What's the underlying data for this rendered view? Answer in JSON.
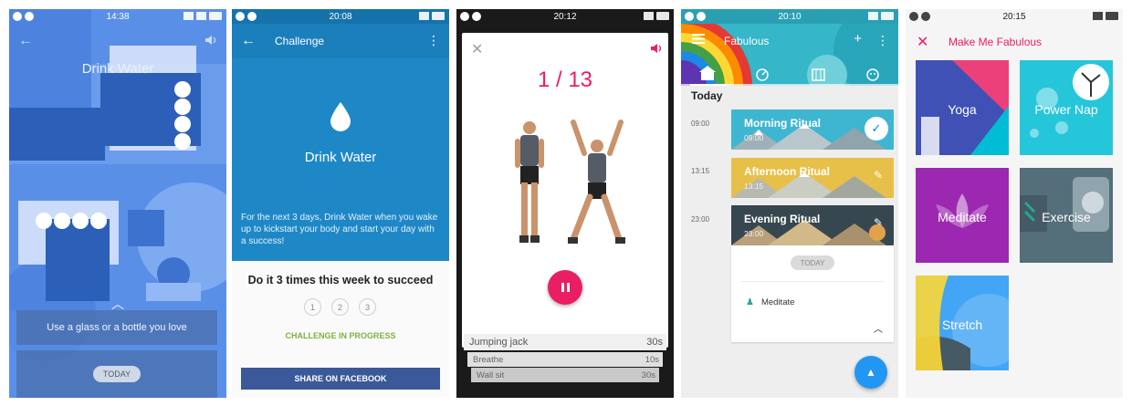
{
  "screens": [
    {
      "status_time": "14:38",
      "title": "Drink Water",
      "tip": "Use a glass or a bottle you love",
      "today_label": "TODAY"
    },
    {
      "status_time": "20:08",
      "appbar_title": "Challenge",
      "habit_name": "Drink Water",
      "description": "For the next 3 days, Drink Water when you wake up to kickstart your body and start your day with a success!",
      "goal": "Do it 3 times this week to succeed",
      "steps": [
        "1",
        "2",
        "3"
      ],
      "status": "CHALLENGE IN PROGRESS",
      "share_label": "SHARE ON FACEBOOK"
    },
    {
      "status_time": "20:12",
      "counter": "1 / 13",
      "queue": [
        {
          "name": "Jumping jack",
          "duration": "30s"
        },
        {
          "name": "Breathe",
          "duration": "10s"
        },
        {
          "name": "Wall sit",
          "duration": "30s"
        }
      ]
    },
    {
      "status_time": "20:10",
      "appbar_title": "Fabulous",
      "section": "Today",
      "rituals": [
        {
          "time": "09:00",
          "name": "Morning Ritual",
          "sub": "09:00"
        },
        {
          "time": "13:15",
          "name": "Afternoon Ritual",
          "sub": "13:15"
        },
        {
          "time": "23:00",
          "name": "Evening Ritual",
          "sub": "23:00"
        }
      ],
      "today_pill": "TODAY",
      "habit": "Meditate"
    },
    {
      "status_time": "20:15",
      "title": "Make Me Fabulous",
      "tiles": [
        "Yoga",
        "Power Nap",
        "Meditate",
        "Exercise",
        "Stretch"
      ]
    }
  ],
  "colors": {
    "accent_pink": "#e91e63",
    "challenge_blue": "#1e88c7",
    "facebook_blue": "#3b5998",
    "progress_green": "#7cb342",
    "fab_blue": "#2196f3"
  }
}
